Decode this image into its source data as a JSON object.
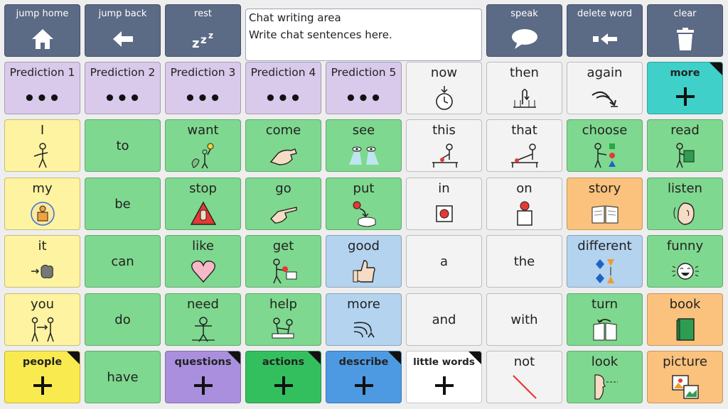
{
  "nav": {
    "jump_home": "jump home",
    "jump_back": "jump back",
    "rest": "rest",
    "speak": "speak",
    "delete_word": "delete word",
    "clear": "clear"
  },
  "chat": {
    "title": "Chat writing area",
    "placeholder": "Write chat sentences here."
  },
  "predictions": [
    "Prediction 1",
    "Prediction 2",
    "Prediction 3",
    "Prediction 4",
    "Prediction 5"
  ],
  "prediction_dots": "•••",
  "row1": {
    "now": "now",
    "then": "then",
    "again": "again",
    "more_folder": "more"
  },
  "row2": [
    "I",
    "to",
    "want",
    "come",
    "see",
    "this",
    "that",
    "choose",
    "read"
  ],
  "row3": [
    "my",
    "be",
    "stop",
    "go",
    "put",
    "in",
    "on",
    "story",
    "listen"
  ],
  "row4": [
    "it",
    "can",
    "like",
    "get",
    "good",
    "a",
    "the",
    "different",
    "funny"
  ],
  "row5": [
    "you",
    "do",
    "need",
    "help",
    "more",
    "and",
    "with",
    "turn",
    "book"
  ],
  "row6": {
    "people": "people",
    "have": "have",
    "questions": "questions",
    "actions": "actions",
    "describe": "describe",
    "little_words": "little words",
    "not": "not",
    "look": "look",
    "picture": "picture"
  },
  "colors": {
    "nav": "#5b6a85",
    "yellow": "#fdf3a0",
    "green": "#7fd88f",
    "white": "#f3f3f3",
    "blue": "#b3d3ef",
    "orange": "#fbc27d",
    "purple": "#d9c9ea",
    "teal": "#3fd0c9"
  }
}
